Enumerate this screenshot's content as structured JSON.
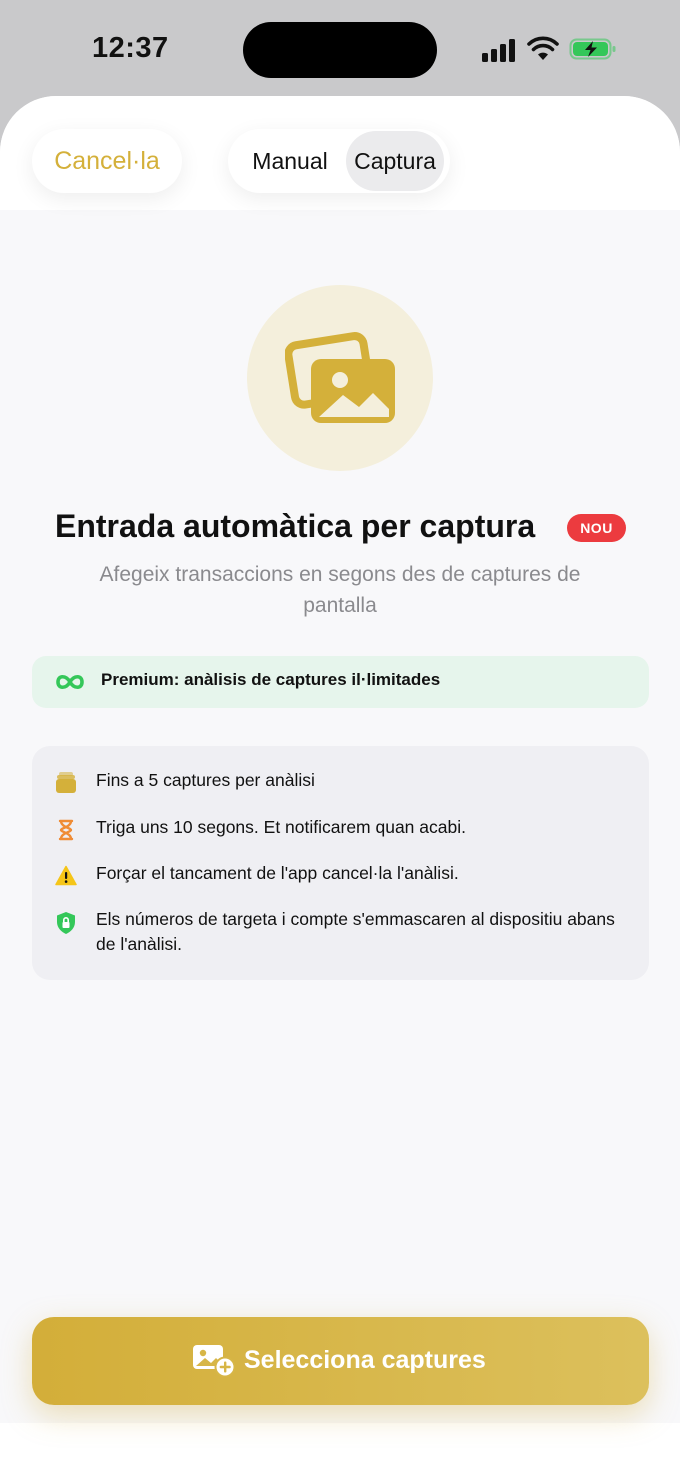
{
  "status_bar": {
    "time": "12:37"
  },
  "header": {
    "cancel_label": "Cancel·la",
    "segments": [
      "Manual",
      "Captura"
    ],
    "selected_segment": "Captura"
  },
  "hero": {
    "icon": "photos-icon",
    "title": "Entrada automàtica per captura",
    "badge": "NOU",
    "subtitle": "Afegeix transaccions en segons des de captures de pantalla"
  },
  "premium": {
    "icon": "infinity-icon",
    "text": "Premium: anàlisis de captures il·limitades"
  },
  "info_items": [
    {
      "icon": "stack-icon",
      "text": "Fins a 5 captures per anàlisi"
    },
    {
      "icon": "hourglass-icon",
      "text": "Triga uns 10 segons. Et notificarem quan acabi."
    },
    {
      "icon": "warning-icon",
      "text": "Forçar el tancament de l'app cancel·la l'anàlisi."
    },
    {
      "icon": "shield-lock-icon",
      "text": "Els números de targeta i compte s'emmascaren al dispositiu abans de l'anàlisi."
    }
  ],
  "cta": {
    "icon": "add-photo-icon",
    "label": "Selecciona captures"
  },
  "colors": {
    "accent": "#d4b03a",
    "badge": "#ec3b3f",
    "premium_bg": "#e6f5ec",
    "premium_icon": "#34c759"
  }
}
